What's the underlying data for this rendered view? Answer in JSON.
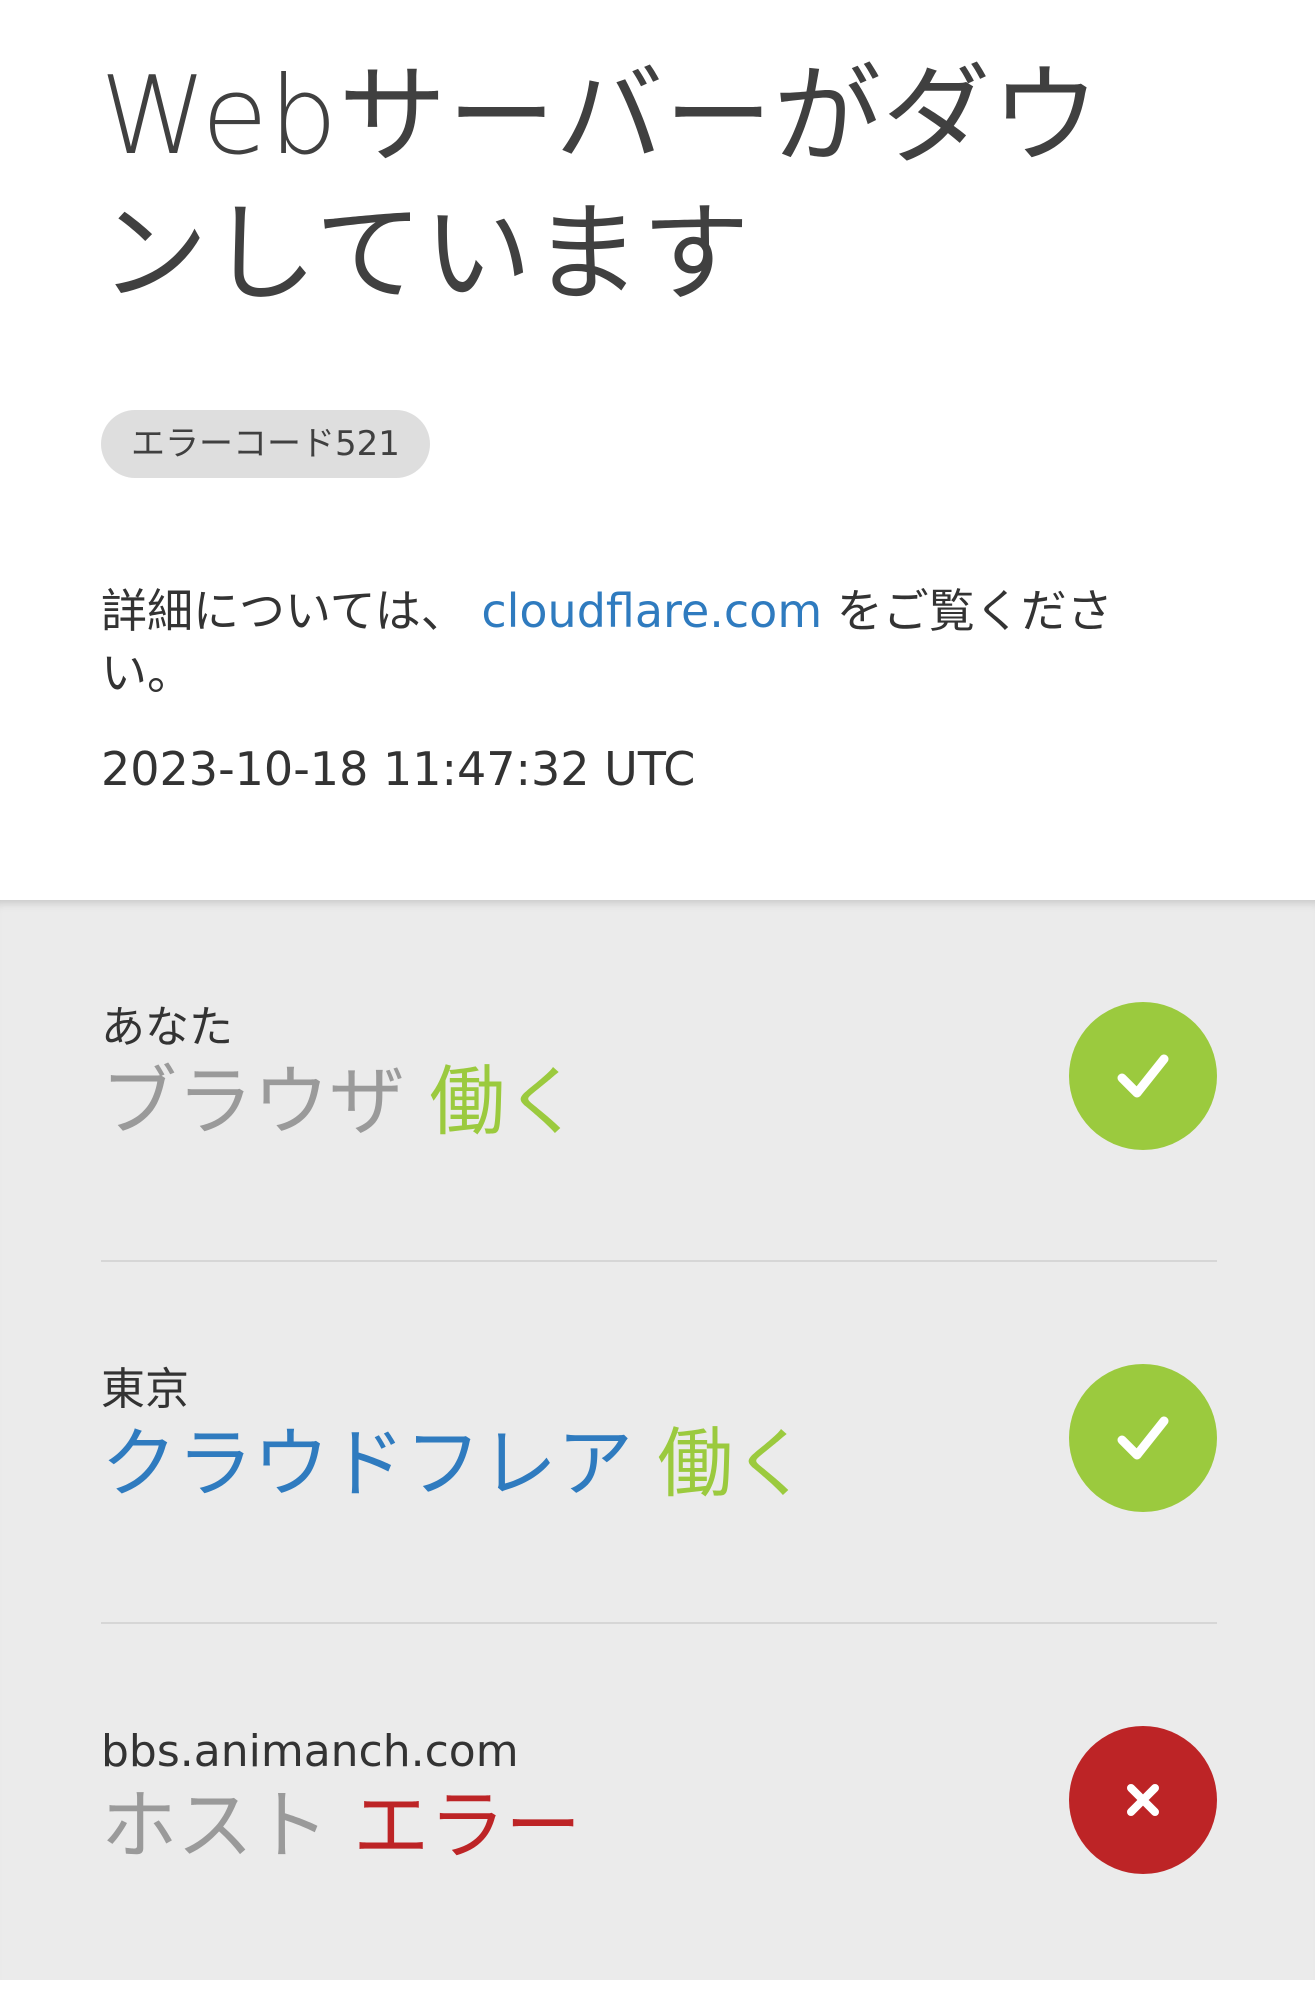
{
  "header": {
    "title": "Webサーバーがダウンしています",
    "error_code": "エラーコード521"
  },
  "info": {
    "prefix": "詳細については、",
    "link_text": "cloudflare.com",
    "suffix": "をご覧ください。",
    "timestamp": "2023-10-18 11:47:32 UTC"
  },
  "status": {
    "items": [
      {
        "location": "あなた",
        "role": "ブラウザ",
        "state": "働く",
        "state_type": "ok",
        "icon": "check-icon"
      },
      {
        "location": "東京",
        "role": "クラウドフレア",
        "state": "働く",
        "state_type": "ok",
        "icon": "check-icon"
      },
      {
        "location": "bbs.animanch.com",
        "role": "ホスト",
        "state": "エラー",
        "state_type": "error",
        "icon": "close-icon"
      }
    ]
  },
  "colors": {
    "ok": "#9bca3e",
    "error": "#bd2426",
    "link": "#2f7bbf"
  }
}
